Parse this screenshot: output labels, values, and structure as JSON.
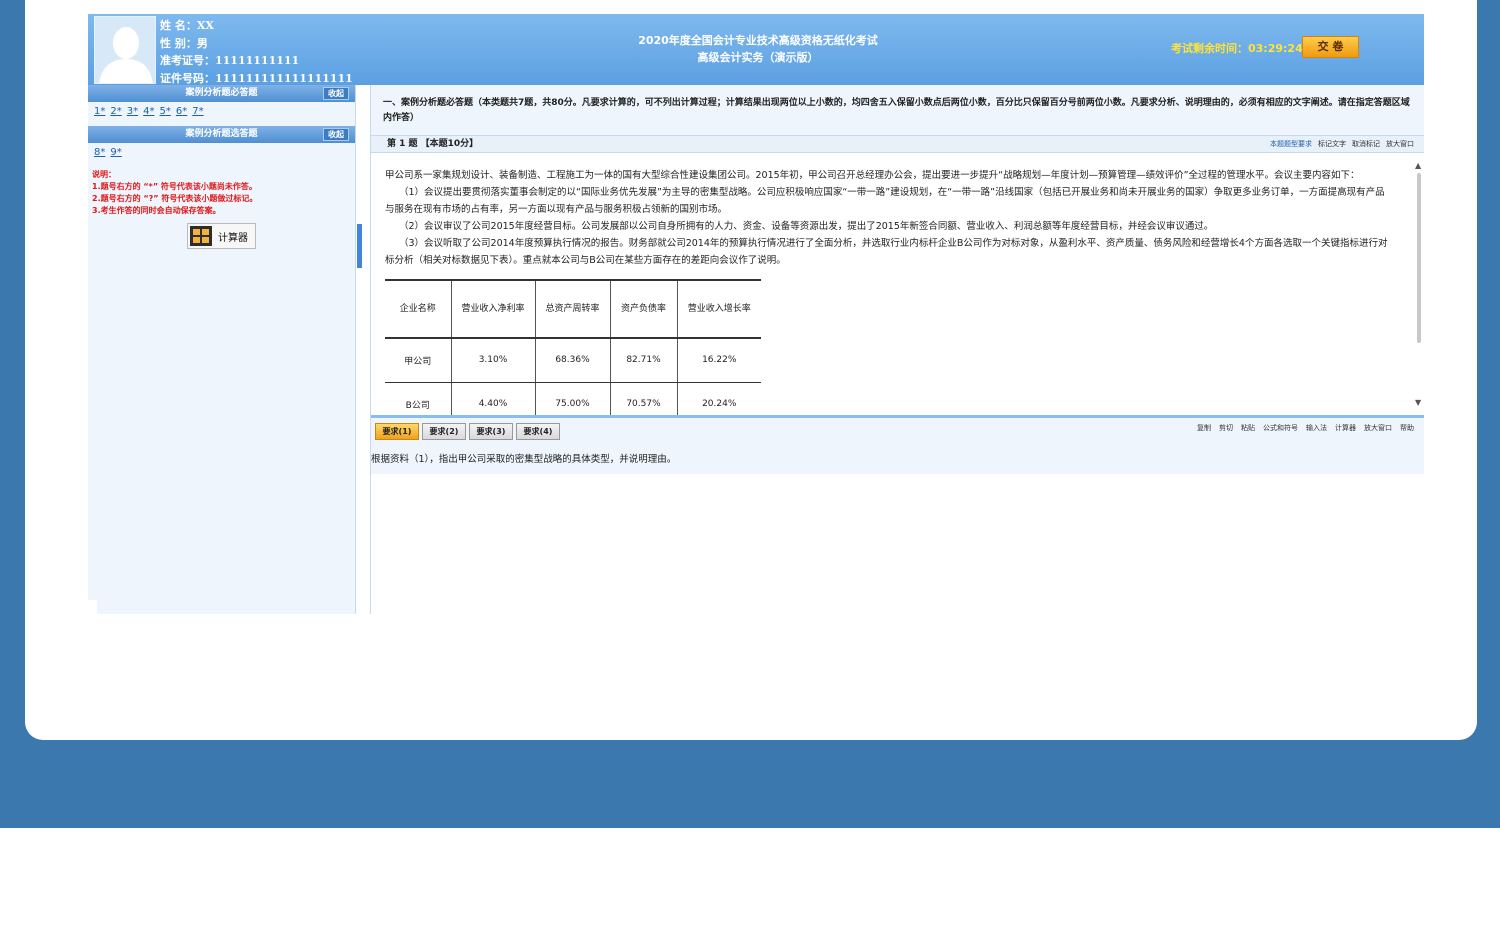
{
  "header": {
    "candidate": [
      {
        "label": "姓    名：",
        "value": "XX"
      },
      {
        "label": "性    别：",
        "value": "男"
      },
      {
        "label": "准考证号：",
        "value": "11111111111"
      },
      {
        "label": "证件号码：",
        "value": "111111111111111111"
      }
    ],
    "exam_title_line1": "2020年度全国会计专业技术高级资格无纸化考试",
    "exam_title_line2": "高级会计实务（演示版）",
    "timer_label": "考试剩余时间：",
    "timer_value": "03:29:24",
    "submit_label": "交 卷"
  },
  "sidebar": {
    "section1": {
      "title": "案例分析题必答题",
      "collapse": "收起",
      "questions": [
        "1",
        "2",
        "3",
        "4",
        "5",
        "6",
        "7"
      ]
    },
    "section2": {
      "title": "案例分析题选答题",
      "collapse": "收起",
      "questions": [
        "8",
        "9"
      ]
    },
    "notes": {
      "title": "说明：",
      "lines": [
        "1.题号右方的 “*” 符号代表该小题尚未作答。",
        "2.题号右方的 “?” 符号代表该小题做过标记。",
        "3.考生作答的同时会自动保存答案。"
      ]
    },
    "calculator_label": "计算器"
  },
  "question": {
    "instructions": "一、案例分析题必答题（本类题共7题，共80分。凡要求计算的，可不列出计算过程；计算结果出现两位以上小数的，均四舍五入保留小数点后两位小数，百分比只保留百分号前两位小数。凡要求分析、说明理由的，必须有相应的文字阐述。请在指定答题区域内作答）",
    "header": "第 1 题 【本题10分】",
    "tools": [
      "本题题型要求",
      "标记文字",
      "取消标记",
      "放大窗口"
    ],
    "paragraphs": [
      "甲公司系一家集规划设计、装备制造、工程施工为一体的国有大型综合性建设集团公司。2015年初，甲公司召开总经理办公会，提出要进一步提升“战略规划—年度计划—预算管理—绩效评价”全过程的管理水平。会议主要内容如下：",
      "（1）会议提出要贯彻落实董事会制定的以“国际业务优先发展”为主导的密集型战略。公司应积极响应国家“一带一路”建设规划，在“一带一路”沿线国家（包括已开展业务和尚未开展业务的国家）争取更多业务订单，一方面提高现有产品与服务在现有市场的占有率，另一方面以现有产品与服务积极占领新的国别市场。",
      "（2）会议审议了公司2015年度经营目标。公司发展部以公司自身所拥有的人力、资金、设备等资源出发，提出了2015年新签合同额、营业收入、利润总额等年度经营目标，并经会议审议通过。",
      "（3）会议听取了公司2014年度预算执行情况的报告。财务部就公司2014年的预算执行情况进行了全面分析，并选取行业内标杆企业B公司作为对标对象，从盈利水平、资产质量、债务风险和经营增长4个方面各选取一个关键指标进行对标分析（相关对标数据见下表）。重点就本公司与B公司在某些方面存在的差距向会议作了说明。"
    ],
    "table": {
      "headers": [
        "企业名称",
        "营业收入净利率",
        "总资产周转率",
        "资产负债率",
        "营业收入增长率"
      ],
      "rows": [
        [
          "甲公司",
          "3.10%",
          "68.36%",
          "82.71%",
          "16.22%"
        ],
        [
          "B公司",
          "4.40%",
          "75.00%",
          "70.57%",
          "20.24%"
        ]
      ]
    }
  },
  "answer": {
    "tabs": [
      "要求(1)",
      "要求(2)",
      "要求(3)",
      "要求(4)"
    ],
    "tools": [
      "复制",
      "剪切",
      "粘贴",
      "公式和符号",
      "输入法",
      "计算器",
      "放大窗口",
      "帮助"
    ],
    "requirement_text": "根据资料（1），指出甲公司采取的密集型战略的具体类型，并说明理由。"
  }
}
